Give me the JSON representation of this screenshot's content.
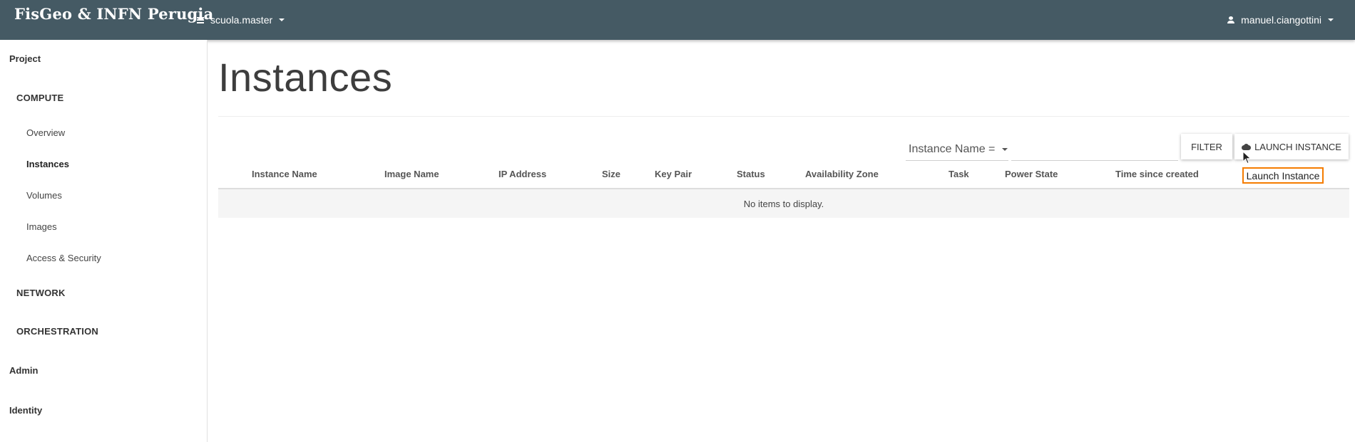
{
  "navbar": {
    "brand": "FisGeo & INFN Perugia",
    "project": "scuola.master",
    "user": "manuel.ciangottini"
  },
  "sidebar": {
    "project": "Project",
    "compute": "COMPUTE",
    "compute_items": [
      "Overview",
      "Instances",
      "Volumes",
      "Images",
      "Access & Security"
    ],
    "active_item": "Instances",
    "network": "NETWORK",
    "orchestration": "ORCHESTRATION",
    "admin": "Admin",
    "identity": "Identity"
  },
  "main": {
    "title": "Instances",
    "filter_field": "Instance Name =",
    "filter_value": "",
    "filter_button": "FILTER",
    "launch_button": "LAUNCH INSTANCE",
    "columns": [
      "Instance Name",
      "Image Name",
      "IP Address",
      "Size",
      "Key Pair",
      "Status",
      "Availability Zone",
      "Task",
      "Power State",
      "Time since created"
    ],
    "empty_message": "No items to display."
  },
  "tooltip": "Launch Instance",
  "colors": {
    "navbar": "#455a64",
    "tooltip_border": "#f57c00",
    "empty_row": "#f5f5f5"
  }
}
